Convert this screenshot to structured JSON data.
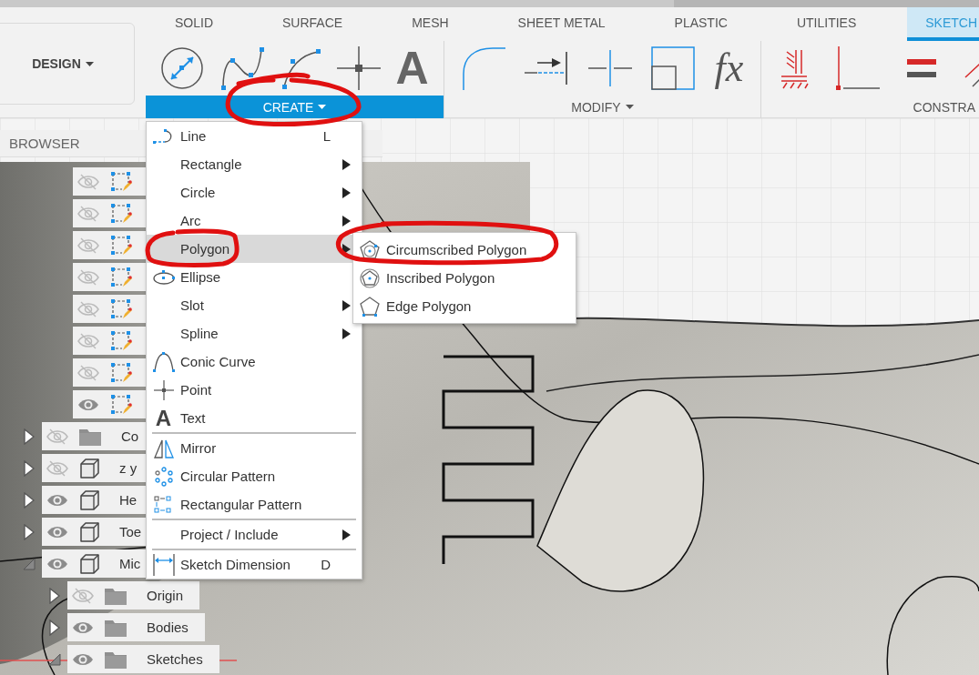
{
  "workspace": {
    "label": "DESIGN"
  },
  "tabs": [
    {
      "label": "SOLID",
      "selected": false
    },
    {
      "label": "SURFACE",
      "selected": false
    },
    {
      "label": "MESH",
      "selected": false
    },
    {
      "label": "SHEET METAL",
      "selected": false
    },
    {
      "label": "PLASTIC",
      "selected": false
    },
    {
      "label": "UTILITIES",
      "selected": false
    },
    {
      "label": "SKETCH",
      "selected": true
    }
  ],
  "tool_groups": [
    {
      "label": "CREATE",
      "active": true,
      "caret": true,
      "tools": [
        {
          "kind": "circle"
        },
        {
          "kind": "spline"
        },
        {
          "kind": "conic"
        },
        {
          "kind": "point"
        },
        {
          "kind": "glyph",
          "glyph": "A"
        }
      ]
    },
    {
      "label": "MODIFY",
      "active": false,
      "caret": true,
      "tools": [
        {
          "kind": "fillet"
        },
        {
          "kind": "extend"
        },
        {
          "kind": "break"
        },
        {
          "kind": "offset"
        },
        {
          "kind": "formula",
          "glyph": "fx"
        }
      ]
    },
    {
      "label": "CONSTRA",
      "active": false,
      "caret": false,
      "tools": [
        {
          "kind": "fix"
        },
        {
          "kind": "perpendicular"
        },
        {
          "kind": "equal"
        },
        {
          "kind": "parallel"
        }
      ]
    }
  ],
  "browser": {
    "title": "BROWSER",
    "sketch_items": [
      {
        "visible": false
      },
      {
        "visible": false
      },
      {
        "visible": false
      },
      {
        "visible": false
      },
      {
        "visible": false
      },
      {
        "visible": false
      },
      {
        "visible": false
      },
      {
        "visible": true
      }
    ],
    "tree": [
      {
        "name": "Co",
        "kind": "folder",
        "visible": false,
        "expanded": false
      },
      {
        "name": "z y",
        "kind": "body",
        "visible": false,
        "expanded": false
      },
      {
        "name": "He",
        "kind": "body",
        "visible": true,
        "expanded": false
      },
      {
        "name": "Toe",
        "kind": "body",
        "visible": true,
        "expanded": false
      },
      {
        "name": "Mic",
        "kind": "body",
        "visible": true,
        "expanded": true,
        "children": [
          {
            "name": "Origin",
            "kind": "folder",
            "visible": false,
            "expanded": false
          },
          {
            "name": "Bodies",
            "kind": "folder",
            "visible": true,
            "expanded": false
          },
          {
            "name": "Sketches",
            "kind": "folder",
            "visible": true,
            "expanded": true
          }
        ]
      }
    ]
  },
  "create_menu": {
    "sections": [
      [
        {
          "label": "Line",
          "kind": "line",
          "shortcut": "L",
          "submenu": false,
          "selected": false
        },
        {
          "label": "Rectangle",
          "kind": "plain",
          "submenu": true,
          "selected": false
        },
        {
          "label": "Circle",
          "kind": "plain",
          "submenu": true,
          "selected": false
        },
        {
          "label": "Arc",
          "kind": "plain",
          "submenu": true,
          "selected": false
        },
        {
          "label": "Polygon",
          "kind": "plain",
          "submenu": true,
          "selected": true
        },
        {
          "label": "Ellipse",
          "kind": "ellipse",
          "submenu": false,
          "selected": false
        },
        {
          "label": "Slot",
          "kind": "plain",
          "submenu": true,
          "selected": false
        },
        {
          "label": "Spline",
          "kind": "plain",
          "submenu": true,
          "selected": false
        },
        {
          "label": "Conic Curve",
          "kind": "conic",
          "submenu": false,
          "selected": false
        },
        {
          "label": "Point",
          "kind": "point",
          "submenu": false,
          "selected": false
        },
        {
          "label": "Text",
          "kind": "glyph",
          "glyph": "A",
          "submenu": false,
          "selected": false
        }
      ],
      [
        {
          "label": "Mirror",
          "kind": "mirror",
          "submenu": false,
          "selected": false
        },
        {
          "label": "Circular Pattern",
          "kind": "circular",
          "submenu": false,
          "selected": false
        },
        {
          "label": "Rectangular Pattern",
          "kind": "rectangular",
          "submenu": false,
          "selected": false
        }
      ],
      [
        {
          "label": "Project / Include",
          "kind": "plain",
          "submenu": true,
          "selected": false
        }
      ],
      [
        {
          "label": "Sketch Dimension",
          "kind": "dimension",
          "shortcut": "D",
          "submenu": false,
          "selected": false
        }
      ]
    ]
  },
  "polygon_submenu": {
    "items": [
      {
        "label": "Circumscribed Polygon",
        "kind": "circumscribed"
      },
      {
        "label": "Inscribed Polygon",
        "kind": "inscribed"
      },
      {
        "label": "Edge Polygon",
        "kind": "edge"
      }
    ]
  }
}
